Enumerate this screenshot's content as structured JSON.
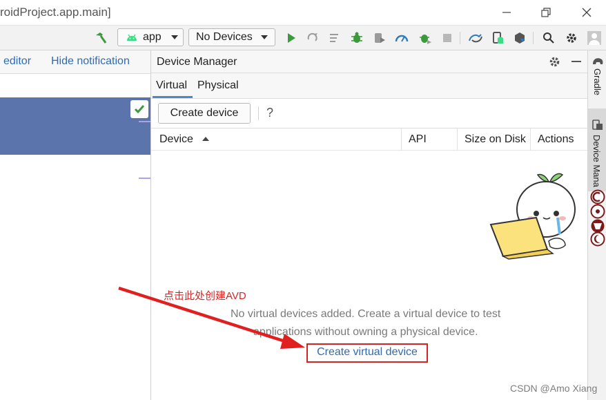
{
  "window": {
    "title": "roidProject.app.main]"
  },
  "toolbar": {
    "run_config": "app",
    "device_selector": "No Devices"
  },
  "editor": {
    "notification_link_1": "editor",
    "notification_link_2": "Hide notification"
  },
  "device_manager": {
    "title": "Device Manager",
    "tabs": [
      "Virtual",
      "Physical"
    ],
    "active_tab": "Virtual",
    "create_device_label": "Create device",
    "help_label": "?",
    "columns": [
      "Device",
      "API",
      "Size on Disk",
      "Actions"
    ],
    "empty_line_1": "No virtual devices added. Create a virtual device to test",
    "empty_line_2": "applications without owning a physical device.",
    "create_virtual_device_link": "Create virtual device"
  },
  "right_stripe": {
    "gradle": "Gradle",
    "device_manager": "Device Mana"
  },
  "annotation": {
    "text": "点击此处创建AVD",
    "color": "#e02020"
  },
  "watermark": "CSDN @Amo Xiang",
  "colors": {
    "accent": "#4a88c7",
    "link": "#2f6bb3",
    "selection": "#5b75ac",
    "run_green": "#3b9a3b",
    "highlight_red": "#d02525"
  }
}
